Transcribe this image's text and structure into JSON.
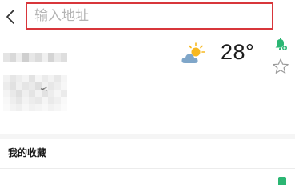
{
  "nav": {
    "back_icon": "chevron-left-icon"
  },
  "address": {
    "placeholder": "输入地址",
    "value": ""
  },
  "weather": {
    "icon": "partly-cloudy-icon",
    "temperature": "28°"
  },
  "actions": {
    "bell_icon": "bell-plus-icon",
    "star_icon": "star-outline-icon"
  },
  "favorites": {
    "title": "我的收藏"
  },
  "colors": {
    "address_border": "#d8363b",
    "accent_green": "#2bb673",
    "sun": "#f7b820",
    "cloud": "#7fa6c9"
  }
}
